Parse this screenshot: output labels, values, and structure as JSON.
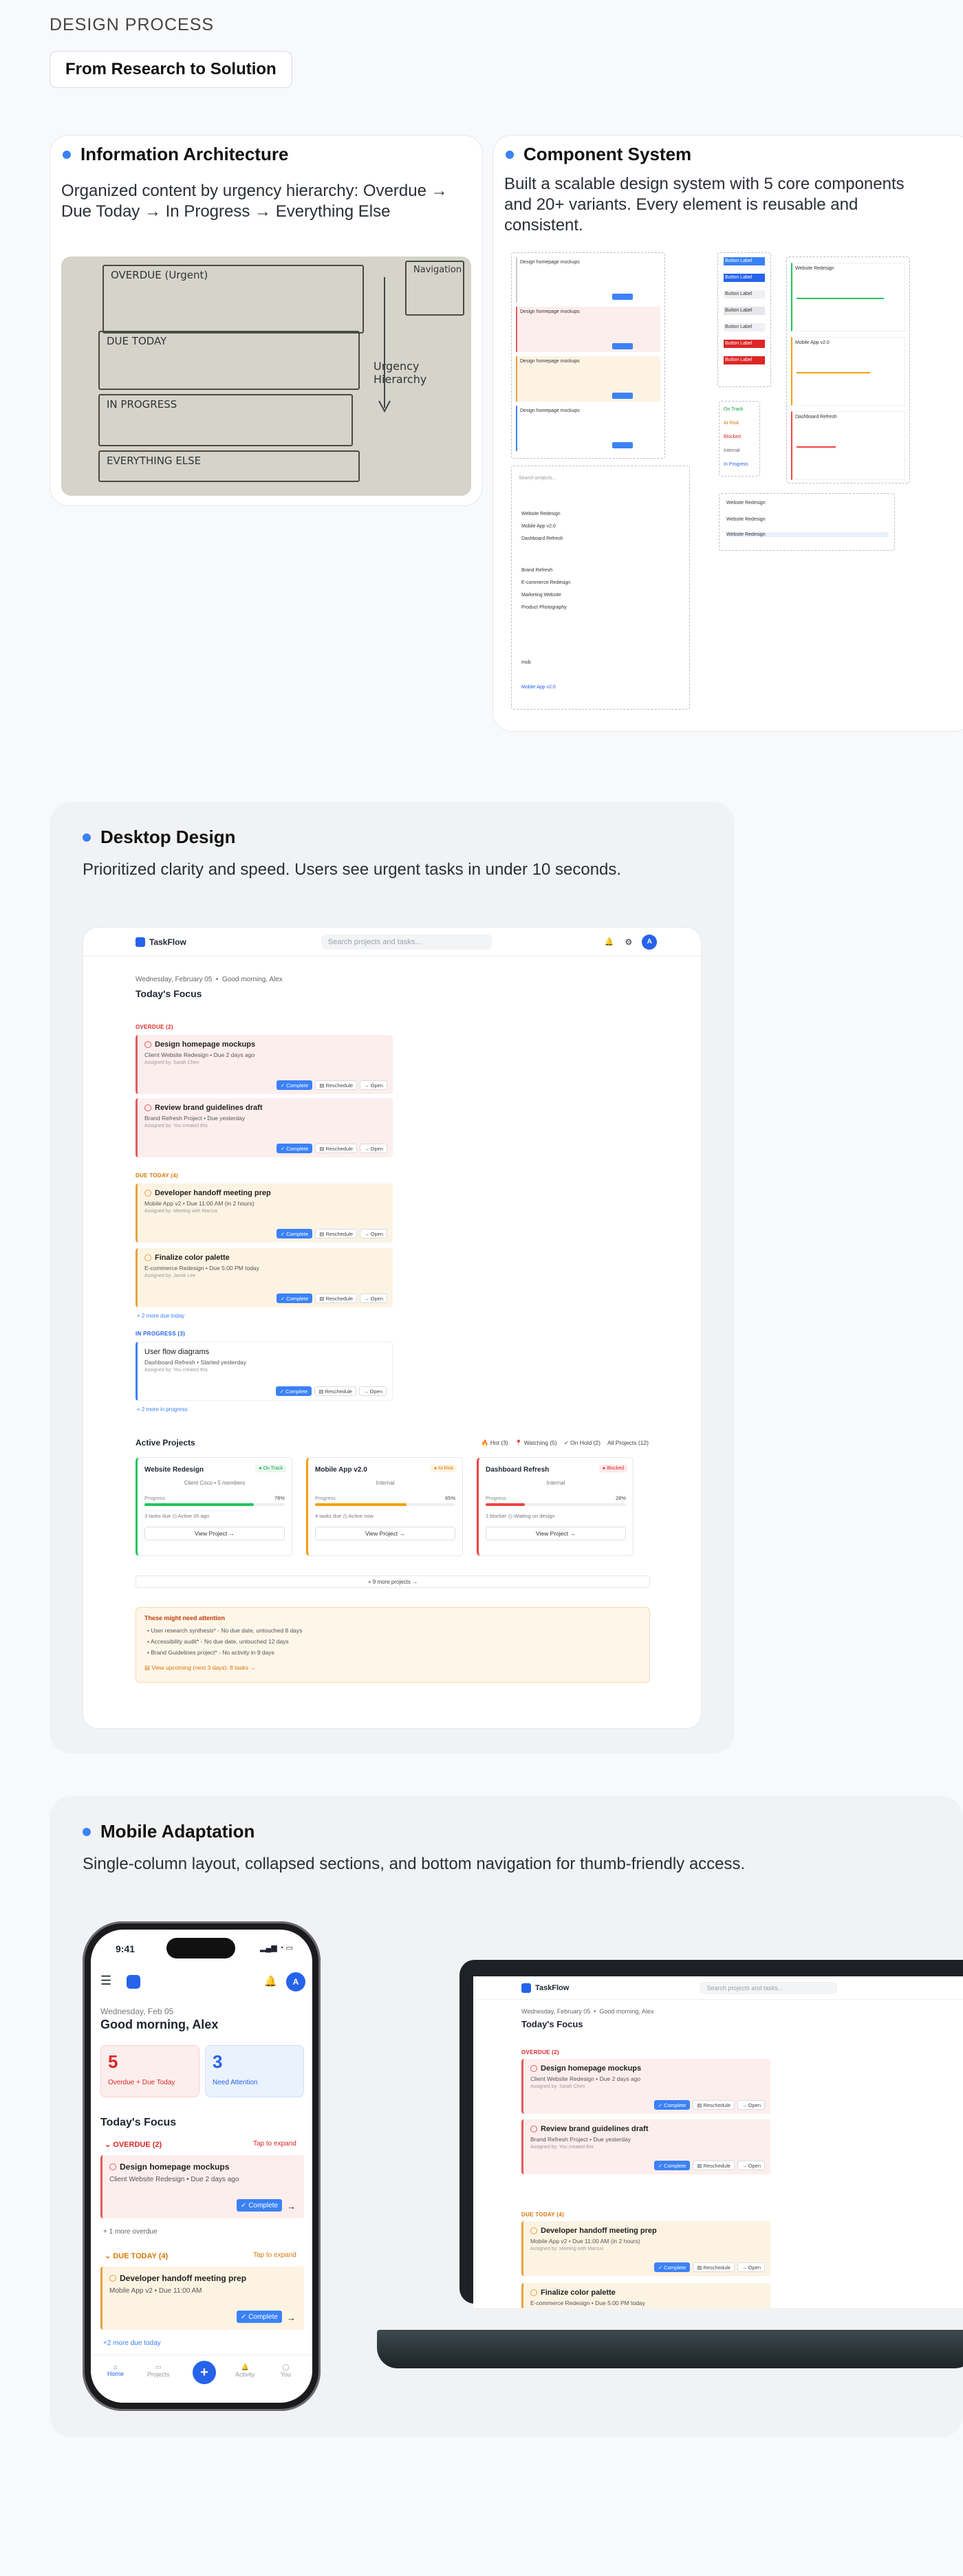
{
  "section_label": "DESIGN PROCESS",
  "pill": "From Research to Solution",
  "ia": {
    "title": "Information Architecture",
    "text": "Organized content by urgency hierarchy: Overdue → Due Today → In Progress → Everything Else",
    "sketch": {
      "overdue": "OVERDUE (Urgent)",
      "due": "DUE TODAY",
      "prog": "IN PROGRESS",
      "else": "EVERYTHING ELSE",
      "nav": "Navigation",
      "urg": "Urgency Hierarchy"
    }
  },
  "cs": {
    "title": "Component System",
    "text": "Built a scalable design system with 5 core components and 20+ variants. Every element is reusable and consistent.",
    "cards": [
      "Design homepage mockups",
      "Design homepage mockups",
      "Design homepage mockups",
      "Design homepage mockups"
    ],
    "buttons": [
      "Button Label",
      "Button Label",
      "Button Label",
      "Button Label",
      "Button Label",
      "Button Label",
      "Button Label"
    ],
    "projects": [
      "Website Redesign",
      "Mobile App v2.0",
      "Dashboard Refresh"
    ],
    "search": "Search projects...",
    "list": [
      "Website Redesign",
      "Mobile App v2.0",
      "Dashboard Refresh"
    ],
    "list2": [
      "Brand Refresh",
      "E-commerce Redesign",
      "Marketing Website",
      "Product Photography"
    ],
    "tags": [
      "On Track",
      "At Risk",
      "Blocked",
      "Internal",
      "In Progress"
    ],
    "nav": [
      "Website Redesign",
      "Website Redesign",
      "Website Redesign"
    ],
    "input": "mob",
    "input_res": "Mobile App v2.0"
  },
  "dd": {
    "title": "Desktop Design",
    "text": "Prioritized clarity and speed. Users see urgent tasks in under 10 seconds."
  },
  "app": {
    "brand": "TaskFlow",
    "search": "Search projects and tasks...",
    "avatar": "A",
    "date": "Wednesday, February 05",
    "greet": "Good morning, Alex",
    "focus": "Today's Focus",
    "g_overdue": "OVERDUE (2)",
    "g_due": "DUE TODAY (4)",
    "g_prog": "IN PROGRESS (3)",
    "tasks": [
      {
        "t": "Design homepage mockups",
        "m": "Client Website Redesign  •  Due 2 days ago",
        "b": "Assigned by: Sarah Chen"
      },
      {
        "t": "Review brand guidelines draft",
        "m": "Brand Refresh Project  •  Due yesterday",
        "b": "Assigned by: You created this"
      },
      {
        "t": "Developer handoff meeting prep",
        "m": "Mobile App v2  •  Due 11:00 AM (in 2 hours)",
        "b": "Assigned by: Meeting with Marcus"
      },
      {
        "t": "Finalize color palette",
        "m": "E-commerce Redesign  •  Due 5:00 PM today",
        "b": "Assigned by: Jamie Lee"
      },
      {
        "t": "User flow diagrams",
        "m": "Dashboard Refresh  •  Started yesterday",
        "b": "Assigned by: You created this"
      }
    ],
    "complete": "✓ Complete",
    "resched": "▤ Reschedule",
    "open": "→ Open",
    "more_due": "+ 2 more due today",
    "more_prog": "+ 2 more in progress",
    "active": "Active Projects",
    "filters": [
      "🔥 Hot (3)",
      "📍 Watching (5)",
      "✓ On Hold (2)",
      "All Projects (12)"
    ],
    "projects": [
      {
        "n": "Website Redesign",
        "badge": "● On Track",
        "sub": "Client Coco  •  5 members",
        "pct": "78%",
        "f": "3 tasks due   ◷ Active 2h ago",
        "v": 0.78
      },
      {
        "n": "Mobile App v2.0",
        "badge": "● At Risk",
        "sub": "Internal",
        "pct": "65%",
        "f": "4 tasks due   ◷ Active now",
        "v": 0.65
      },
      {
        "n": "Dashboard Refresh",
        "badge": "● Blocked",
        "sub": "Internal",
        "pct": "28%",
        "f": "1 blocker   ◷ Waiting on design",
        "v": 0.28
      }
    ],
    "progress": "Progress",
    "view": "View Project  →",
    "more_proj": "+ 9 more projects  →",
    "attn": "These might need attention",
    "attn_items": [
      "• User research synthesis* - No due date, untouched 8 days",
      "• Accessibility audit* - No due date, untouched 12 days",
      "• Brand Guidelines project* - No activity in 9 days"
    ],
    "attn_link": "▤ View upcoming (next 3 days): 8 tasks →"
  },
  "ma": {
    "title": "Mobile Adaptation",
    "text": "Single-column layout, collapsed sections, and bottom navigation for thumb-friendly access."
  },
  "phone": {
    "time": "9:41",
    "avatar": "A",
    "date": "Wednesday, Feb 05",
    "greet": "Good morning, Alex",
    "n1": "5",
    "l1": "Overdue + Due Today",
    "n2": "3",
    "l2": "Need Attention",
    "focus": "Today's Focus",
    "g1": "OVERDUE (2)",
    "tap": "Tap to expand",
    "t1": "Design homepage mockups",
    "m1": "Client Website Redesign  •  Due 2 days ago",
    "complete": "✓ Complete",
    "more1": "+ 1 more overdue",
    "g2": "DUE TODAY (4)",
    "t2": "Developer handoff meeting prep",
    "m2": "Mobile App v2  •  Due 11:00 AM",
    "more2": "+2 more due today",
    "nav": [
      "Home",
      "Projects",
      "",
      "Activity",
      "You"
    ]
  },
  "lap": {
    "t3": "Developer handoff meeting prep",
    "m3": "Mobile App v2  •  Due 11:00 AM (in 2 hours)",
    "b3": "Assigned by: Meeting with Marcus",
    "t4": "Finalize color palette",
    "m4": "E-commerce Redesign  •  Due 5:00 PM today"
  }
}
